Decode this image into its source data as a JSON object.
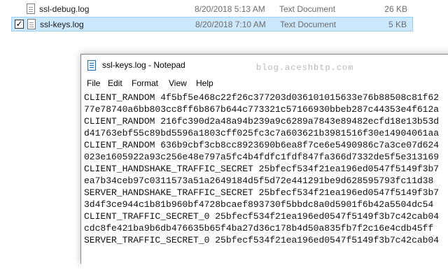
{
  "explorer": {
    "files": [
      {
        "name": "ssl-debug.log",
        "date": "8/20/2018 5:13 AM",
        "type": "Text Document",
        "size": "26 KB"
      },
      {
        "name": "ssl-keys.log",
        "date": "8/20/2018 7:10 AM",
        "type": "Text Document",
        "size": "5 KB"
      }
    ]
  },
  "notepad": {
    "title": "ssl-keys.log - Notepad",
    "watermark": "blog.aceshbtp.com",
    "menu": [
      "File",
      "Edit",
      "Format",
      "View",
      "Help"
    ],
    "lines": [
      "CLIENT_RANDOM 4f5bf5e468c22f26c377203d036101015633e76b88508c81f62",
      "77e78740a6bb803cc8ff6b867b644c773321c57166930bbeb287c44353e4f612a",
      "CLIENT_RANDOM 216fc390d2a48a94b239a9c6289a7843e89482ecfd18e13b53d",
      "d41763ebf55c89bd5596a1803cff025fc3c7a603621b3981516f30e14904061aa",
      "CLIENT_RANDOM 636b9cbf3cb8cc8923690b6ea8f7ce6e5490986c7a3ce07d624",
      "023e1605922a93c256e48e797a5fc4b4fdfc1fdf847fa366d7332de5f5e313169",
      "CLIENT_HANDSHAKE_TRAFFIC_SECRET 25bfecf534f21ea196ed0547f5149f3b7",
      "ea7b34ceb97c0311573a51a2649184d5f5d72e441291be9d628595793fc11d38",
      "SERVER_HANDSHAKE_TRAFFIC_SECRET 25bfecf534f21ea196ed0547f5149f3b7",
      "3d4f3ce944c1b81b960bf4728bcaef893730f5bbdc8a0d5901f6b42a5504dc54",
      "CLIENT_TRAFFIC_SECRET_0 25bfecf534f21ea196ed0547f5149f3b7c42cab04",
      "cdc8fe421ba9b6db476635b65f4ba27d36c178b4d50a835fb7f2c16e4cdb45ff",
      "SERVER_TRAFFIC_SECRET_0 25bfecf534f21ea196ed0547f5149f3b7c42cab04"
    ]
  }
}
